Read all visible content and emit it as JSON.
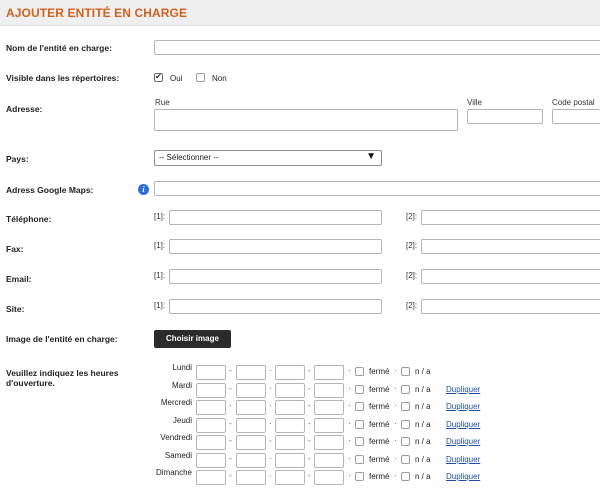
{
  "header": {
    "title": "AJOUTER ENTITÉ EN CHARGE"
  },
  "fields": {
    "name_label": "Nom de l'entité en charge:",
    "visible_label": "Visible dans les répertoires:",
    "visible_yes": "Oui",
    "visible_no": "Non",
    "visible_value": "Oui",
    "address_label": "Adresse:",
    "street_label": "Rue",
    "city_label": "Ville",
    "postal_label": "Code postal",
    "country_label": "Pays:",
    "country_selected": "-- Sélectionner --",
    "gmaps_label": "Adress Google Maps:",
    "phone_label": "Téléphone:",
    "fax_label": "Fax:",
    "email_label": "Email:",
    "site_label": "Site:",
    "idx1": "[1]:",
    "idx2": "[2]:",
    "image_label": "Image de l'entité en charge:",
    "image_button": "Choisir image",
    "hours_label_1": "Veuillez indiquez les heures",
    "hours_label_2": "d'ouverture."
  },
  "hours": {
    "closed_label": "fermé",
    "na_label": "n / a",
    "duplicate_label": "Dupliquer",
    "dash": "-",
    "dot": "·",
    "days": [
      "Lundi",
      "Mardi",
      "Mercredi",
      "Jeudi",
      "Vendredi",
      "Samedi",
      "Dimanche"
    ]
  },
  "icons": {
    "info": "info-icon",
    "dropdown": "chevron-down-icon"
  },
  "colors": {
    "title": "#d0601c",
    "link": "#1f4fa8",
    "button": "#2b2b2b",
    "info": "#2f6fd4"
  }
}
